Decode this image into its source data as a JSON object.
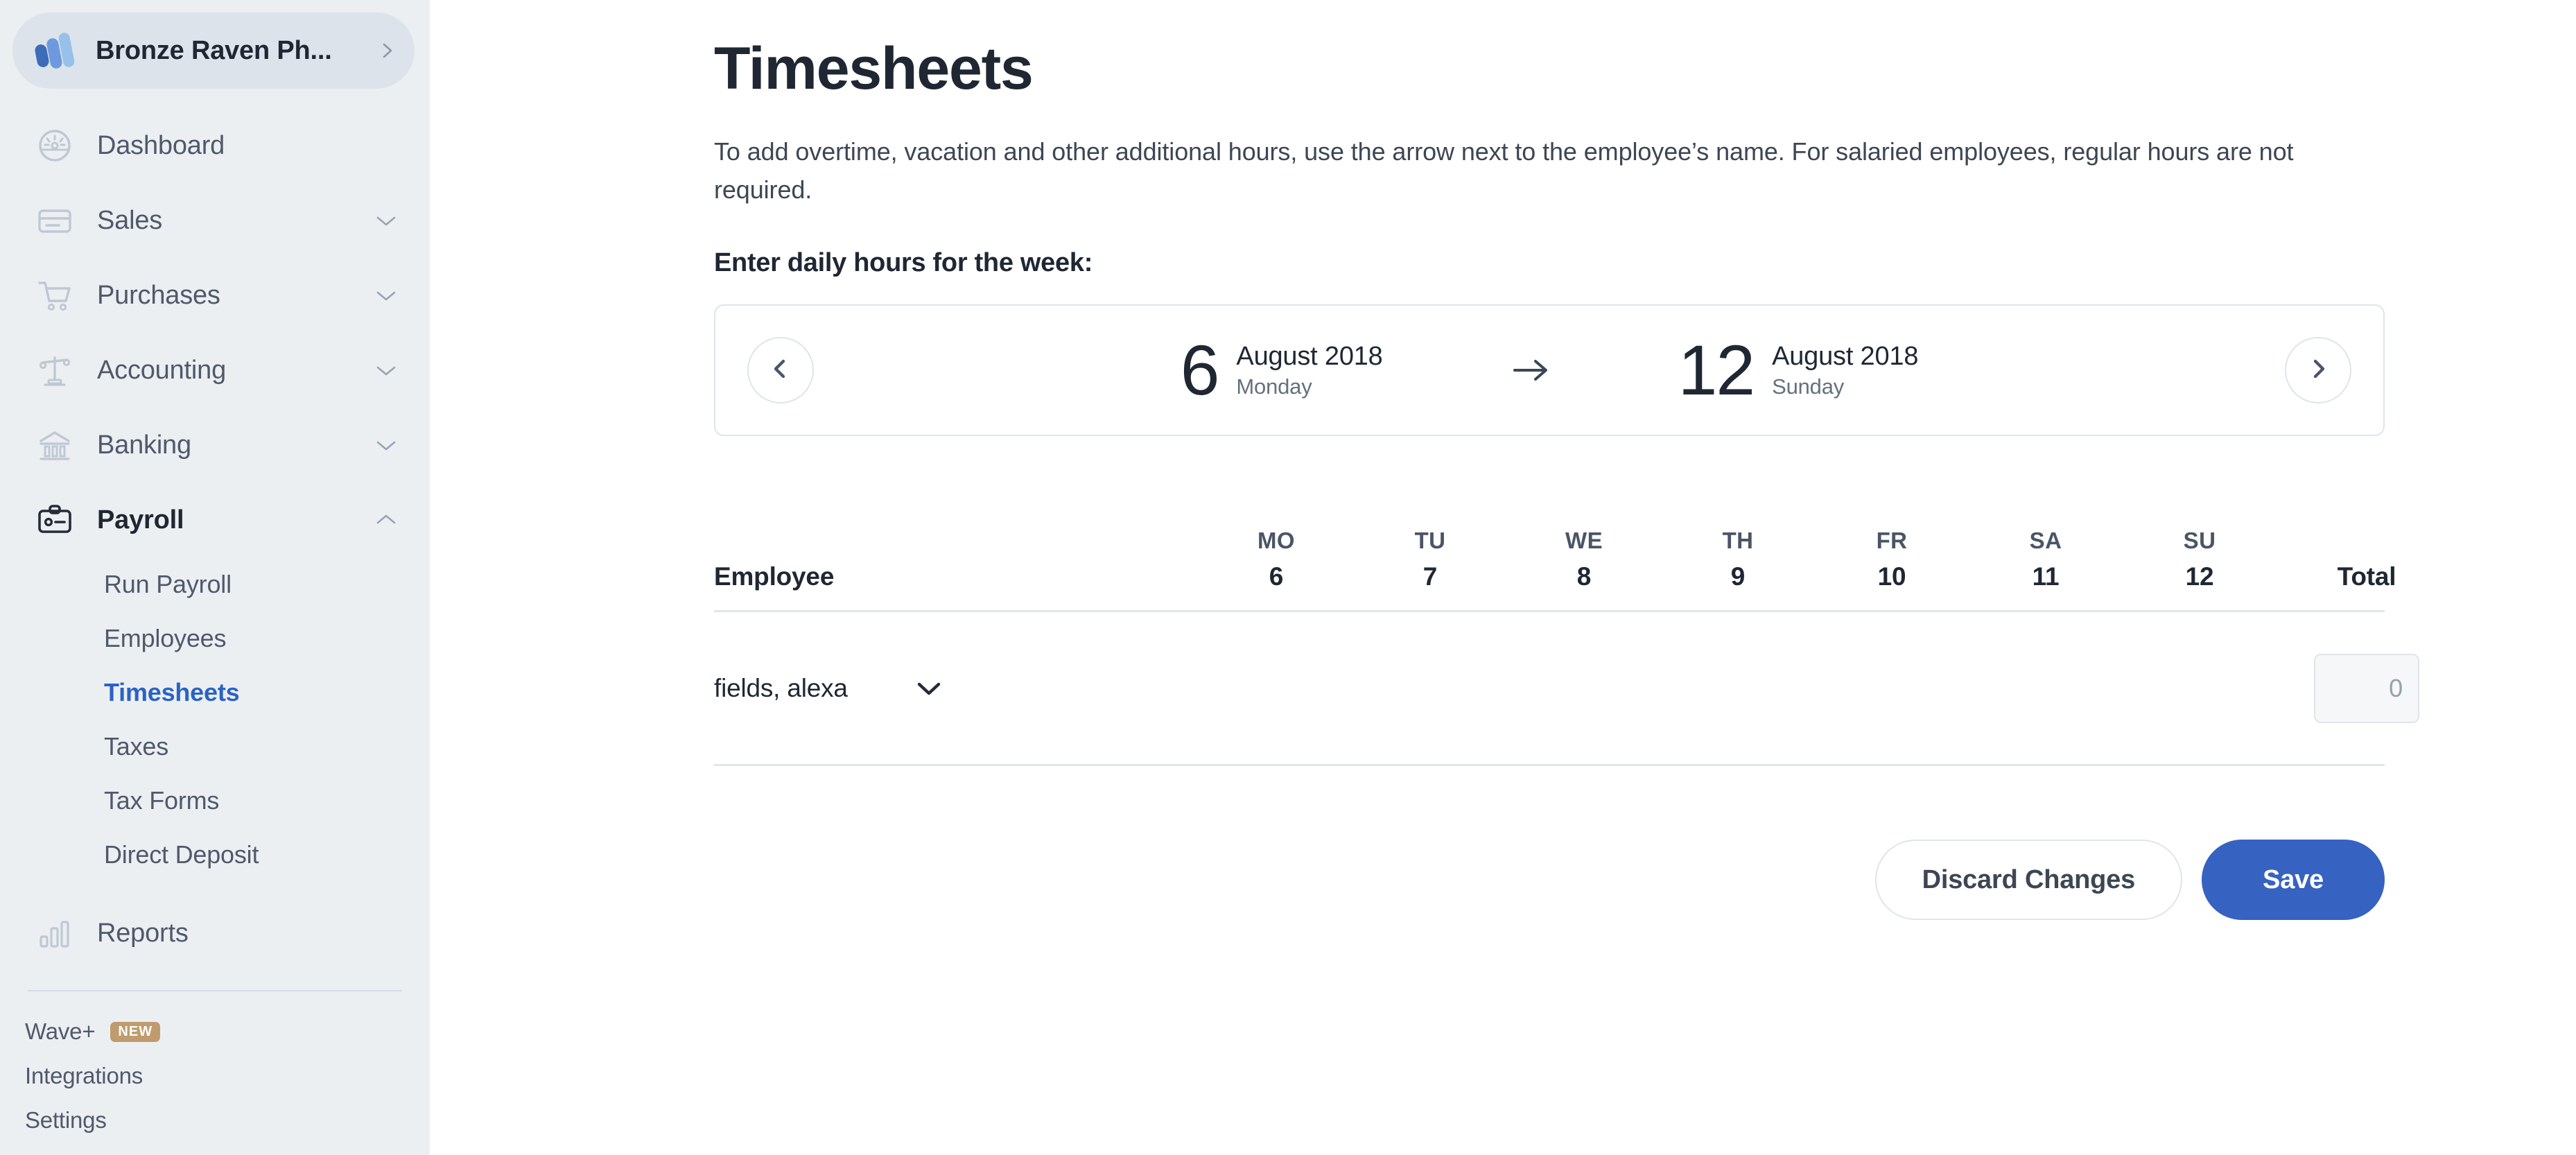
{
  "sidebar": {
    "org": {
      "name": "Bronze Raven Ph...",
      "chevron_icon": "chevron-right-icon",
      "logo_icon": "wave-logo-icon"
    },
    "nav": [
      {
        "label": "Dashboard",
        "icon": "dashboard-gauge-icon",
        "has_caret": false,
        "active": false
      },
      {
        "label": "Sales",
        "icon": "credit-card-icon",
        "has_caret": true,
        "active": false
      },
      {
        "label": "Purchases",
        "icon": "shopping-cart-icon",
        "has_caret": true,
        "active": false
      },
      {
        "label": "Accounting",
        "icon": "scales-balance-icon",
        "has_caret": true,
        "active": false
      },
      {
        "label": "Banking",
        "icon": "bank-building-icon",
        "has_caret": true,
        "active": false
      },
      {
        "label": "Payroll",
        "icon": "id-badge-icon",
        "has_caret": true,
        "active": true
      },
      {
        "label": "Reports",
        "icon": "bar-chart-icon",
        "has_caret": false,
        "active": false
      }
    ],
    "payroll_subnav": [
      {
        "label": "Run Payroll",
        "selected": false
      },
      {
        "label": "Employees",
        "selected": false
      },
      {
        "label": "Timesheets",
        "selected": true
      },
      {
        "label": "Taxes",
        "selected": false
      },
      {
        "label": "Tax Forms",
        "selected": false
      },
      {
        "label": "Direct Deposit",
        "selected": false
      }
    ],
    "footer": [
      {
        "label": "Wave+",
        "badge": "NEW"
      },
      {
        "label": "Integrations",
        "badge": ""
      },
      {
        "label": "Settings",
        "badge": ""
      }
    ],
    "colors": {
      "background": "#eceff2",
      "org_pill": "#dde3ea",
      "active_link": "#2b63c4",
      "badge": "#c09b6e"
    }
  },
  "main": {
    "title": "Timesheets",
    "description": "To add overtime, vacation and other additional hours, use the arrow next to the employee’s name. For salaried employees, regular hours are not required.",
    "section_label": "Enter daily hours for the week:",
    "week": {
      "prev_icon": "chevron-left-icon",
      "next_icon": "chevron-right-icon",
      "range_arrow_icon": "arrow-right-icon",
      "start": {
        "day_number": "6",
        "month_year": "August 2018",
        "weekday": "Monday"
      },
      "end": {
        "day_number": "12",
        "month_year": "August 2018",
        "weekday": "Sunday"
      }
    },
    "table": {
      "employee_header": "Employee",
      "total_header": "Total",
      "days": [
        {
          "dow": "MO",
          "date": "6"
        },
        {
          "dow": "TU",
          "date": "7"
        },
        {
          "dow": "WE",
          "date": "8"
        },
        {
          "dow": "TH",
          "date": "9"
        },
        {
          "dow": "FR",
          "date": "10"
        },
        {
          "dow": "SA",
          "date": "11"
        },
        {
          "dow": "SU",
          "date": "12"
        }
      ],
      "rows": [
        {
          "employee": "fields, alexa",
          "expand_icon": "chevron-down-icon",
          "hours": [
            "",
            "",
            "",
            "",
            "",
            "",
            ""
          ],
          "total": "0"
        }
      ]
    },
    "actions": {
      "discard_label": "Discard Changes",
      "save_label": "Save",
      "primary_color": "#3662c1"
    }
  }
}
